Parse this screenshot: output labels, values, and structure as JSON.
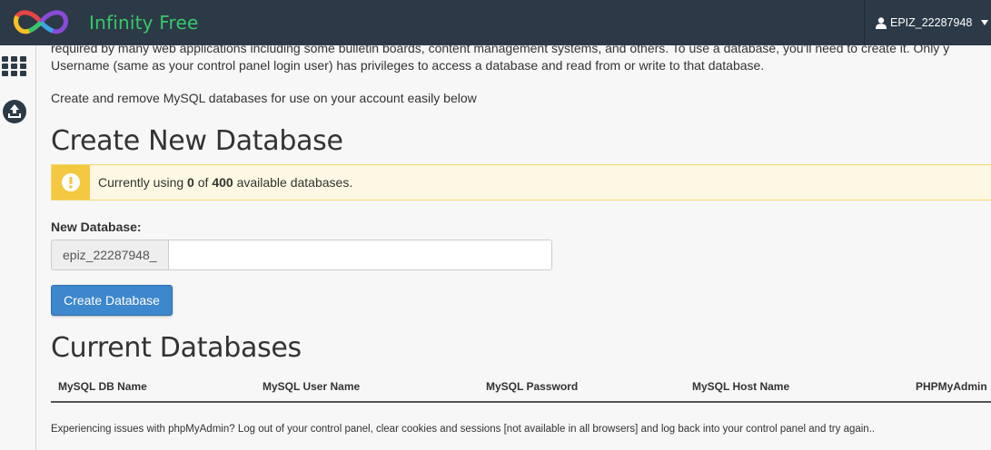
{
  "header": {
    "brand": "Infinity Free",
    "user": "EPIZ_22287948"
  },
  "intro": {
    "line1": "required by many web applications including some bulletin boards, content management systems, and others. To use a database, you'll need to create it. Only y",
    "line2": "Username (same as your control panel login user) has privileges to access a database and read from or write to that database.",
    "line3": "Create and remove MySQL databases for use on your account easily below"
  },
  "create": {
    "title": "Create New Database",
    "alert_prefix": "Currently using",
    "used": "0",
    "alert_of": "of",
    "limit": "400",
    "alert_suffix": "available databases.",
    "label": "New Database:",
    "prefix": "epiz_22287948_",
    "input_value": "",
    "button": "Create Database"
  },
  "current": {
    "title": "Current Databases",
    "columns": [
      "MySQL DB Name",
      "MySQL User Name",
      "MySQL Password",
      "MySQL Host Name",
      "PHPMyAdmin"
    ]
  },
  "footnote": "Experiencing issues with phpMyAdmin? Log out of your control panel, clear cookies and sessions [not available in all browsers] and log back into your control panel and try again..",
  "colors": {
    "topbar": "#2c3a47",
    "brand": "#38c86a",
    "alert_bg": "#fcf8e3",
    "alert_icon": "#f4c840",
    "button": "#3d87cc"
  },
  "icons": [
    "infinity-logo-icon",
    "user-icon",
    "caret-down-icon",
    "apps-grid-icon",
    "upload-icon",
    "exclamation-icon"
  ]
}
